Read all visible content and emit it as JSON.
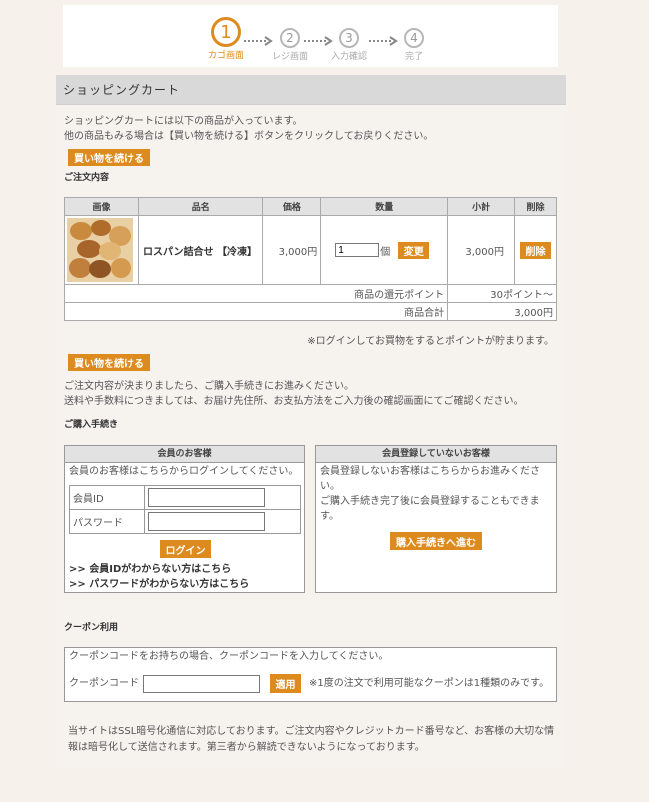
{
  "steps": [
    {
      "num": "1",
      "label": "カゴ画面"
    },
    {
      "num": "2",
      "label": "レジ画面"
    },
    {
      "num": "3",
      "label": "入力確認"
    },
    {
      "num": "4",
      "label": "完了"
    }
  ],
  "page_title": "ショッピングカート",
  "intro": {
    "line1": "ショッピングカートには以下の商品が入っています。",
    "line2": "他の商品もみる場合は【買い物を続ける】ボタンをクリックしてお戻りください。"
  },
  "continue_button": "買い物を続ける",
  "order_heading": "ご注文内容",
  "cart": {
    "headers": {
      "image": "画像",
      "name": "品名",
      "price": "価格",
      "qty": "数量",
      "subtotal": "小計",
      "delete": "削除"
    },
    "item": {
      "name": "ロスパン詰合せ 【冷凍】",
      "price": "3,000円",
      "qty": "1",
      "qty_unit": "個",
      "change": "変更",
      "subtotal": "3,000円",
      "delete": "削除"
    },
    "points_label": "商品の還元ポイント",
    "points_value": "30ポイント～",
    "total_label": "商品合計",
    "total_value": "3,000円"
  },
  "login_note": "※ログインしてお買物をするとポイントが貯まります。",
  "continue_button2": "買い物を続ける",
  "proceed_note": {
    "line1": "ご注文内容が決まりましたら、ご購入手続きにお進みください。",
    "line2": "送料や手数料につきましては、お届け先住所、お支払方法をご入力後の確認画面にてご確認ください。"
  },
  "purchase_heading": "ご購入手続き",
  "member": {
    "title": "会員のお客様",
    "desc": "会員のお客様はこちらからログインしてください。",
    "id_label": "会員ID",
    "pw_label": "パスワード",
    "login_button": "ログイン",
    "forgot_id": ">> 会員IDがわからない方はこちら",
    "forgot_pw": ">> パスワードがわからない方はこちら"
  },
  "guest": {
    "title": "会員登録していないお客様",
    "desc1": "会員登録しないお客様はこちらからお進みくださ",
    "desc2": "い。",
    "desc3": "ご購入手続き完了後に会員登録することもできま",
    "desc4": "す。",
    "button": "購入手続きへ進む"
  },
  "coupon": {
    "heading": "クーポン利用",
    "desc": "クーポンコードをお持ちの場合、クーポンコードを入力してください。",
    "label": "クーポンコード",
    "value": "",
    "apply_button": "適用",
    "note": "※1度の注文で利用可能なクーポンは1種類のみです。"
  },
  "ssl_note": {
    "line1": "当サイトはSSL暗号化通信に対応しております。ご注文内容やクレジットカード番号など、お客様の大切な情",
    "line2": "報は暗号化して送信されます。第三者から解読できないようになっております。"
  },
  "colors": {
    "accent": "#dd8a1f",
    "header_bg": "#d9d9d9",
    "page_bg": "#f6f1ea"
  }
}
